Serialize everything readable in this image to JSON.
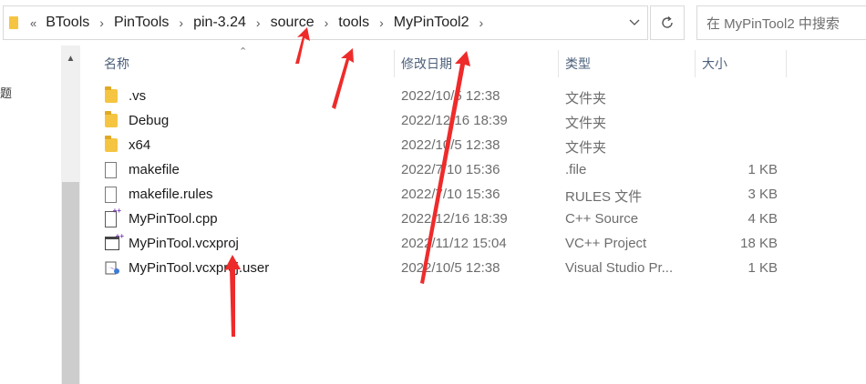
{
  "breadcrumb": {
    "back_glyph": "«",
    "items": [
      "BTools",
      "PinTools",
      "pin-3.24",
      "source",
      "tools",
      "MyPinTool2"
    ],
    "separator": "›"
  },
  "search": {
    "placeholder": "在 MyPinTool2 中搜索"
  },
  "nav_fragment": "题",
  "columns": {
    "name": "名称",
    "date": "修改日期",
    "type": "类型",
    "size": "大小"
  },
  "files": [
    {
      "icon": "folder-icon",
      "name": ".vs",
      "date": "2022/10/5 12:38",
      "type": "文件夹",
      "size": ""
    },
    {
      "icon": "folder-icon",
      "name": "Debug",
      "date": "2022/12/16 18:39",
      "type": "文件夹",
      "size": ""
    },
    {
      "icon": "folder-icon",
      "name": "x64",
      "date": "2022/10/5 12:38",
      "type": "文件夹",
      "size": ""
    },
    {
      "icon": "file-icon",
      "name": "makefile",
      "date": "2022/7/10 15:36",
      "type": ".file",
      "size": "1 KB"
    },
    {
      "icon": "file-icon",
      "name": "makefile.rules",
      "date": "2022/7/10 15:36",
      "type": "RULES 文件",
      "size": "3 KB"
    },
    {
      "icon": "cpp-file-icon",
      "name": "MyPinTool.cpp",
      "date": "2022/12/16 18:39",
      "type": "C++ Source",
      "size": "4 KB"
    },
    {
      "icon": "vcxproj-icon",
      "name": "MyPinTool.vcxproj",
      "date": "2022/11/12 15:04",
      "type": "VC++ Project",
      "size": "18 KB"
    },
    {
      "icon": "visual-studio-user-icon",
      "name": "MyPinTool.vcxproj.user",
      "date": "2022/10/5 12:38",
      "type": "Visual Studio Pr...",
      "size": "1 KB"
    }
  ],
  "colors": {
    "annotation_arrow": "#ee2b2b",
    "folder": "#f5c542",
    "header_text": "#4c607a"
  }
}
